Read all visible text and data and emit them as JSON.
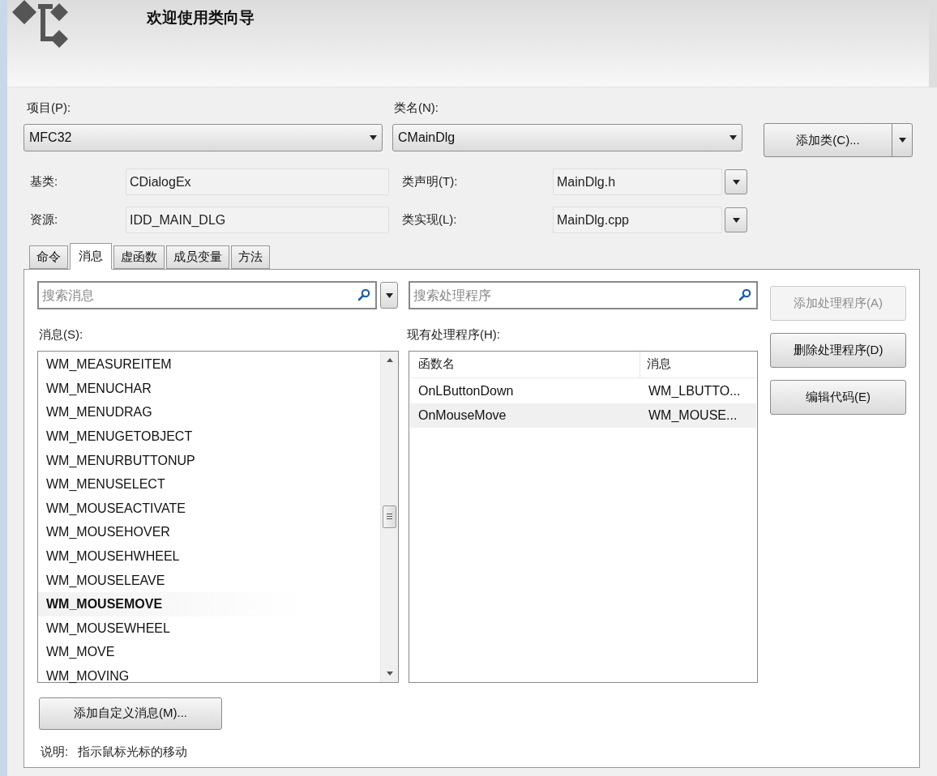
{
  "header": {
    "title": "欢迎使用类向导"
  },
  "project": {
    "label": "项目(P):",
    "value": "MFC32"
  },
  "class_name": {
    "label": "类名(N):",
    "value": "CMainDlg"
  },
  "add_class_button": "添加类(C)...",
  "base_class": {
    "label": "基类:",
    "value": "CDialogEx"
  },
  "resource": {
    "label": "资源:",
    "value": "IDD_MAIN_DLG"
  },
  "class_declaration": {
    "label": "类声明(T):",
    "value": "MainDlg.h"
  },
  "class_implementation": {
    "label": "类实现(L):",
    "value": "MainDlg.cpp"
  },
  "tabs": [
    {
      "label": "命令",
      "selected": false
    },
    {
      "label": "消息",
      "selected": true
    },
    {
      "label": "虚函数",
      "selected": false
    },
    {
      "label": "成员变量",
      "selected": false
    },
    {
      "label": "方法",
      "selected": false
    }
  ],
  "message_search": {
    "placeholder": "搜索消息"
  },
  "handler_search": {
    "placeholder": "搜索处理程序"
  },
  "messages_label": "消息(S):",
  "messages": [
    {
      "name": "WM_MEASUREITEM",
      "selected": false
    },
    {
      "name": "WM_MENUCHAR",
      "selected": false
    },
    {
      "name": "WM_MENUDRAG",
      "selected": false
    },
    {
      "name": "WM_MENUGETOBJECT",
      "selected": false
    },
    {
      "name": "WM_MENURBUTTONUP",
      "selected": false
    },
    {
      "name": "WM_MENUSELECT",
      "selected": false
    },
    {
      "name": "WM_MOUSEACTIVATE",
      "selected": false
    },
    {
      "name": "WM_MOUSEHOVER",
      "selected": false
    },
    {
      "name": "WM_MOUSEHWHEEL",
      "selected": false
    },
    {
      "name": "WM_MOUSELEAVE",
      "selected": false
    },
    {
      "name": "WM_MOUSEMOVE",
      "selected": true
    },
    {
      "name": "WM_MOUSEWHEEL",
      "selected": false
    },
    {
      "name": "WM_MOVE",
      "selected": false
    },
    {
      "name": "WM_MOVING",
      "selected": false
    }
  ],
  "handlers_label": "现有处理程序(H):",
  "handlers": {
    "columns": [
      "函数名",
      "消息"
    ],
    "rows": [
      {
        "cells": [
          "OnLButtonDown",
          "WM_LBUTTO..."
        ],
        "selected": false
      },
      {
        "cells": [
          "OnMouseMove",
          "WM_MOUSE..."
        ],
        "selected": true
      }
    ]
  },
  "side_buttons": [
    {
      "label": "添加处理程序(A)",
      "disabled": true
    },
    {
      "label": "删除处理程序(D)",
      "disabled": false
    },
    {
      "label": "编辑代码(E)",
      "disabled": false
    }
  ],
  "add_custom_message_button": "添加自定义消息(M)...",
  "description": {
    "label": "说明:",
    "text": "指示鼠标光标的移动"
  }
}
